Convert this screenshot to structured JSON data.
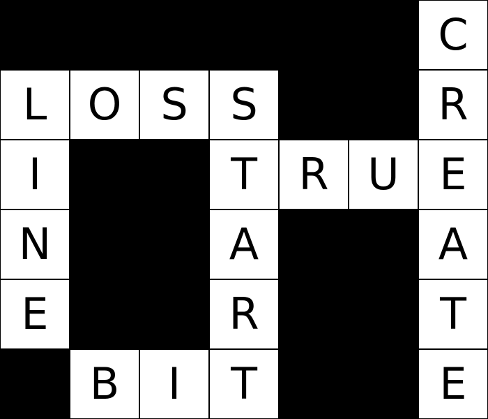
{
  "puzzle": {
    "cols": 7,
    "rows": 6,
    "colors": {
      "cell_fill": "#ffffff",
      "block_fill": "#000000",
      "letter_color": "#000000"
    },
    "grid": [
      [
        "#",
        "#",
        "#",
        "#",
        "#",
        "#",
        "C"
      ],
      [
        "L",
        "O",
        "S",
        "S",
        "#",
        "#",
        "R"
      ],
      [
        "I",
        "#",
        "#",
        "T",
        "R",
        "U",
        "E"
      ],
      [
        "N",
        "#",
        "#",
        "A",
        "#",
        "#",
        "A"
      ],
      [
        "E",
        "#",
        "#",
        "R",
        "#",
        "#",
        "T"
      ],
      [
        "#",
        "B",
        "I",
        "T",
        "#",
        "#",
        "E"
      ]
    ]
  }
}
